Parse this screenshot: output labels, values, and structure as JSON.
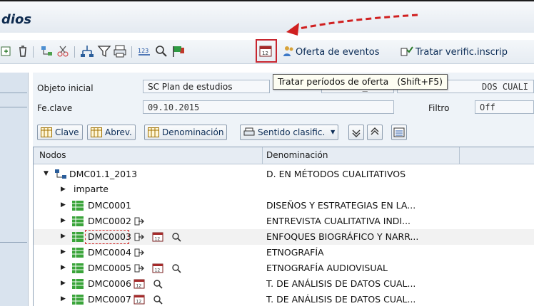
{
  "title": "dios",
  "toolbar": {
    "oferta_label": "Oferta de eventos",
    "tratar_label": "Tratar verific.inscrip"
  },
  "tooltip": {
    "text": "Tratar períodos de oferta",
    "shortcut": "(Shift+F5)"
  },
  "form": {
    "objeto_label": "Objeto inicial",
    "objeto_value": "SC Plan de estudios",
    "objeto_code": "DMC01.1_2013",
    "objeto_desc_tail": "DOS CUALI",
    "feclave_label": "Fe.clave",
    "feclave_value": "09.10.2015",
    "filtro_label": "Filtro",
    "filtro_value": "Off"
  },
  "buttons": {
    "clave": "Clave",
    "abrev": "Abrev.",
    "denominacion": "Denominación",
    "sentido": "Sentido clasific."
  },
  "tree": {
    "col_nodos": "Nodos",
    "col_denominacion": "Denominación",
    "root": {
      "label": "DMC01.1_2013",
      "desc": "D. EN MÉTODOS CUALITATIVOS"
    },
    "group": {
      "label": "imparte"
    },
    "rows": [
      {
        "label": "DMC0001",
        "desc": "DISEÑOS Y ESTRATEGIAS EN LA..."
      },
      {
        "label": "DMC0002",
        "desc": "ENTREVISTA CUALITATIVA INDI..."
      },
      {
        "label": "DMC0003",
        "desc": "ENFOQUES BIOGRÁFICO Y NARR..."
      },
      {
        "label": "DMC0004",
        "desc": "ETNOGRAFÍA"
      },
      {
        "label": "DMC0005",
        "desc": "ETNOGRAFÍA AUDIOVISUAL"
      },
      {
        "label": "DMC0006",
        "desc": "T. DE ANÁLISIS DE DATOS CUAL..."
      },
      {
        "label": "DMC0007",
        "desc": "T. DE ANÁLISIS DE DATOS CUAL..."
      }
    ]
  },
  "colors": {
    "accent_red": "#c8262f",
    "title_blue": "#0f2c50",
    "node_green": "#3aa43a"
  },
  "icons": [
    "expand-icon",
    "delete-icon",
    "structure-icon",
    "cut-icon",
    "hierarchy-icon",
    "filter-icon",
    "print-icon",
    "numbering-icon",
    "search-icon",
    "flag-icon",
    "calendar-icon",
    "persons-icon",
    "check-icon"
  ]
}
